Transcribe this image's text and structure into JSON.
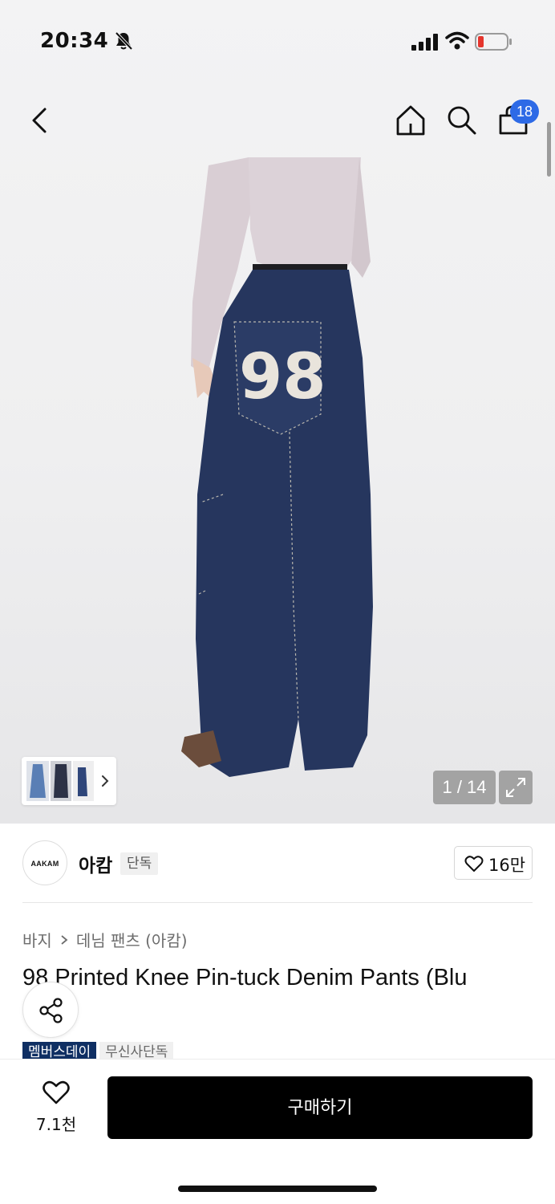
{
  "status_bar": {
    "time": "20:34"
  },
  "nav": {
    "cart_count": "18"
  },
  "gallery": {
    "counter": "1 / 14"
  },
  "brand": {
    "logo_text": "AAKAM",
    "name": "아캄",
    "tag": "단독",
    "likes": "16만"
  },
  "breadcrumb": {
    "category": "바지",
    "subcategory": "데님 팬츠 (아캄)"
  },
  "product": {
    "title": "98 Printed Knee Pin-tuck Denim Pants (Blu",
    "badges": [
      "멤버스데이",
      "무신사단독"
    ]
  },
  "bottom": {
    "wish_count": "7.1천",
    "buy_label": "구매하기"
  },
  "colors": {
    "badge_blue": "#2d6ae6",
    "member_badge": "#0f2f63",
    "denim": "#26365e",
    "button": "#000000"
  }
}
